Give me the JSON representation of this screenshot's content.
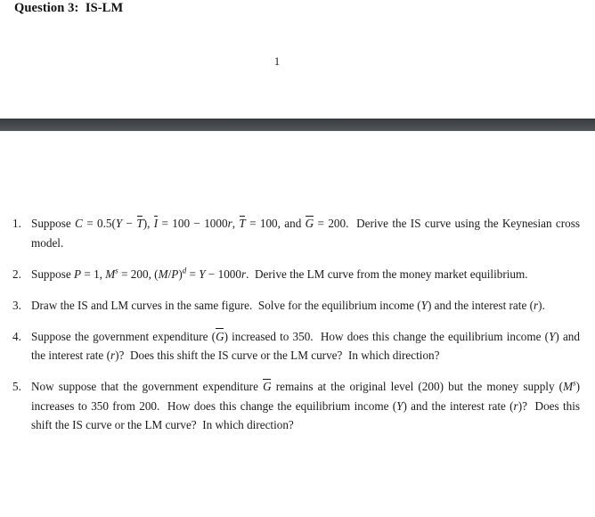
{
  "document": {
    "page_one": {
      "title": "Question 3:  IS-LM",
      "page_number": "1"
    },
    "separator": {
      "color_top": "#3a3f43",
      "color_bottom": "#5c6063"
    },
    "page_two": {
      "questions": [
        {
          "marker": "1.",
          "text": "Suppose C = 0.5(Y − T̄), Ī = 100 − 1000r, T̄ = 100, and Ḡ = 200. Derive the IS curve using the Keynesian cross model."
        },
        {
          "marker": "2.",
          "text": "Suppose P = 1, Mˢ = 200, (M/P)ᵈ = Y − 1000r. Derive the LM curve from the money market equilibrium."
        },
        {
          "marker": "3.",
          "text": "Draw the IS and LM curves in the same figure. Solve for the equilibrium income (Y) and the interest rate (r)."
        },
        {
          "marker": "4.",
          "text": "Suppose the government expenditure (Ḡ) increased to 350. How does this change the equilibrium income (Y) and the interest rate (r)? Does this shift the IS curve or the LM curve? In which direction?"
        },
        {
          "marker": "5.",
          "text": "Now suppose that the government expenditure Ḡ remains at the original level (200) but the money supply (Mˢ) increases to 350 from 200. How does this change the equilibrium income (Y) and the interest rate (r)? Does this shift the IS curve or the LM curve? In which direction?"
        }
      ]
    }
  }
}
